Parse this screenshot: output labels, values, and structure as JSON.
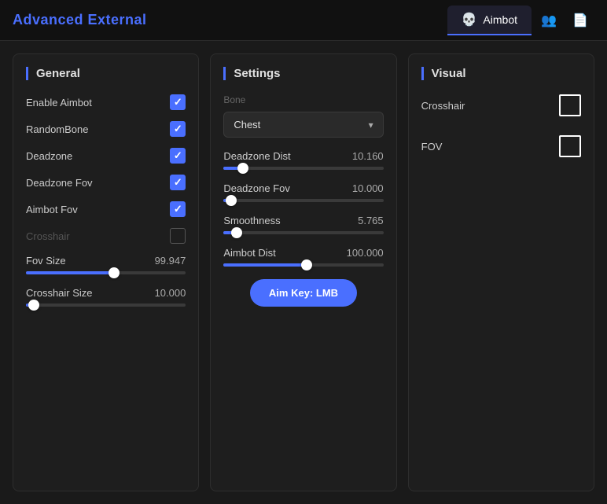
{
  "app": {
    "title": "Advanced External"
  },
  "tabs": [
    {
      "id": "aimbot",
      "label": "Aimbot",
      "icon": "💀",
      "active": true
    },
    {
      "id": "players",
      "label": "",
      "icon": "👥",
      "active": false
    },
    {
      "id": "settings2",
      "label": "",
      "icon": "📄",
      "active": false
    }
  ],
  "general": {
    "title": "General",
    "items": [
      {
        "label": "Enable Aimbot",
        "checked": true
      },
      {
        "label": "RandomBone",
        "checked": true
      },
      {
        "label": "Deadzone",
        "checked": true
      },
      {
        "label": "Deadzone Fov",
        "checked": true
      },
      {
        "label": "Aimbot Fov",
        "checked": true
      },
      {
        "label": "Crosshair",
        "checked": false,
        "disabled": true
      }
    ],
    "fovSize": {
      "label": "Fov Size",
      "value": "99.947",
      "pct": 55
    },
    "crosshairSize": {
      "label": "Crosshair Size",
      "value": "10.000",
      "pct": 5
    }
  },
  "settings": {
    "title": "Settings",
    "bone_label": "Bone",
    "bone_value": "Chest",
    "deadzoneDist": {
      "label": "Deadzone Dist",
      "value": "10.160",
      "pct": 12
    },
    "deadzoneFov": {
      "label": "Deadzone Fov",
      "value": "10.000",
      "pct": 5
    },
    "smoothness": {
      "label": "Smoothness",
      "value": "5.765",
      "pct": 8
    },
    "aimbotDist": {
      "label": "Aimbot Dist",
      "value": "100.000",
      "pct": 52
    },
    "aimKeyLabel": "Aim Key: LMB"
  },
  "visual": {
    "title": "Visual",
    "crosshair": {
      "label": "Crosshair"
    },
    "fov": {
      "label": "FOV"
    }
  }
}
